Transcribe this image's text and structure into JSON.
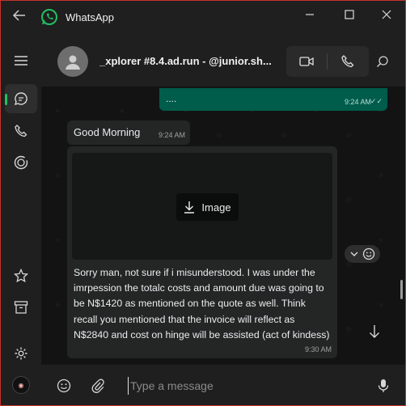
{
  "app": {
    "title": "WhatsApp"
  },
  "window_controls": {
    "minimize": "minimize",
    "maximize": "maximize",
    "close": "close"
  },
  "chat": {
    "contact_name": "_xplorer #8.4.ad.run - @junior.sh..."
  },
  "messages": [
    {
      "direction": "out",
      "text": "....",
      "time": "9:24 AM",
      "status": "read"
    },
    {
      "direction": "in",
      "text": "Good Morning",
      "time": "9:24 AM"
    },
    {
      "direction": "in",
      "media_label": "Image",
      "text": "Sorry man, not sure if i misunderstood. I was under the imrpession the totalc costs and amount due was going to be N$1420 as mentioned on the quote as well. Think recall you mentioned that the invoice will reflect as N$2840 and cost on hinge will be assisted (act of kindess)",
      "time": "9:30 AM"
    }
  ],
  "composer": {
    "placeholder": "Type a message",
    "value": ""
  },
  "icons": {
    "back": "back-arrow-icon",
    "chats": "chat-icon",
    "calls": "phone-icon",
    "status": "status-icon",
    "starred": "star-icon",
    "archived": "archive-icon",
    "settings": "gear-icon"
  },
  "colors": {
    "accent_green": "#21c063",
    "outgoing_bubble": "#005c4b",
    "incoming_bubble": "#242626",
    "window_border": "#c4322b"
  }
}
